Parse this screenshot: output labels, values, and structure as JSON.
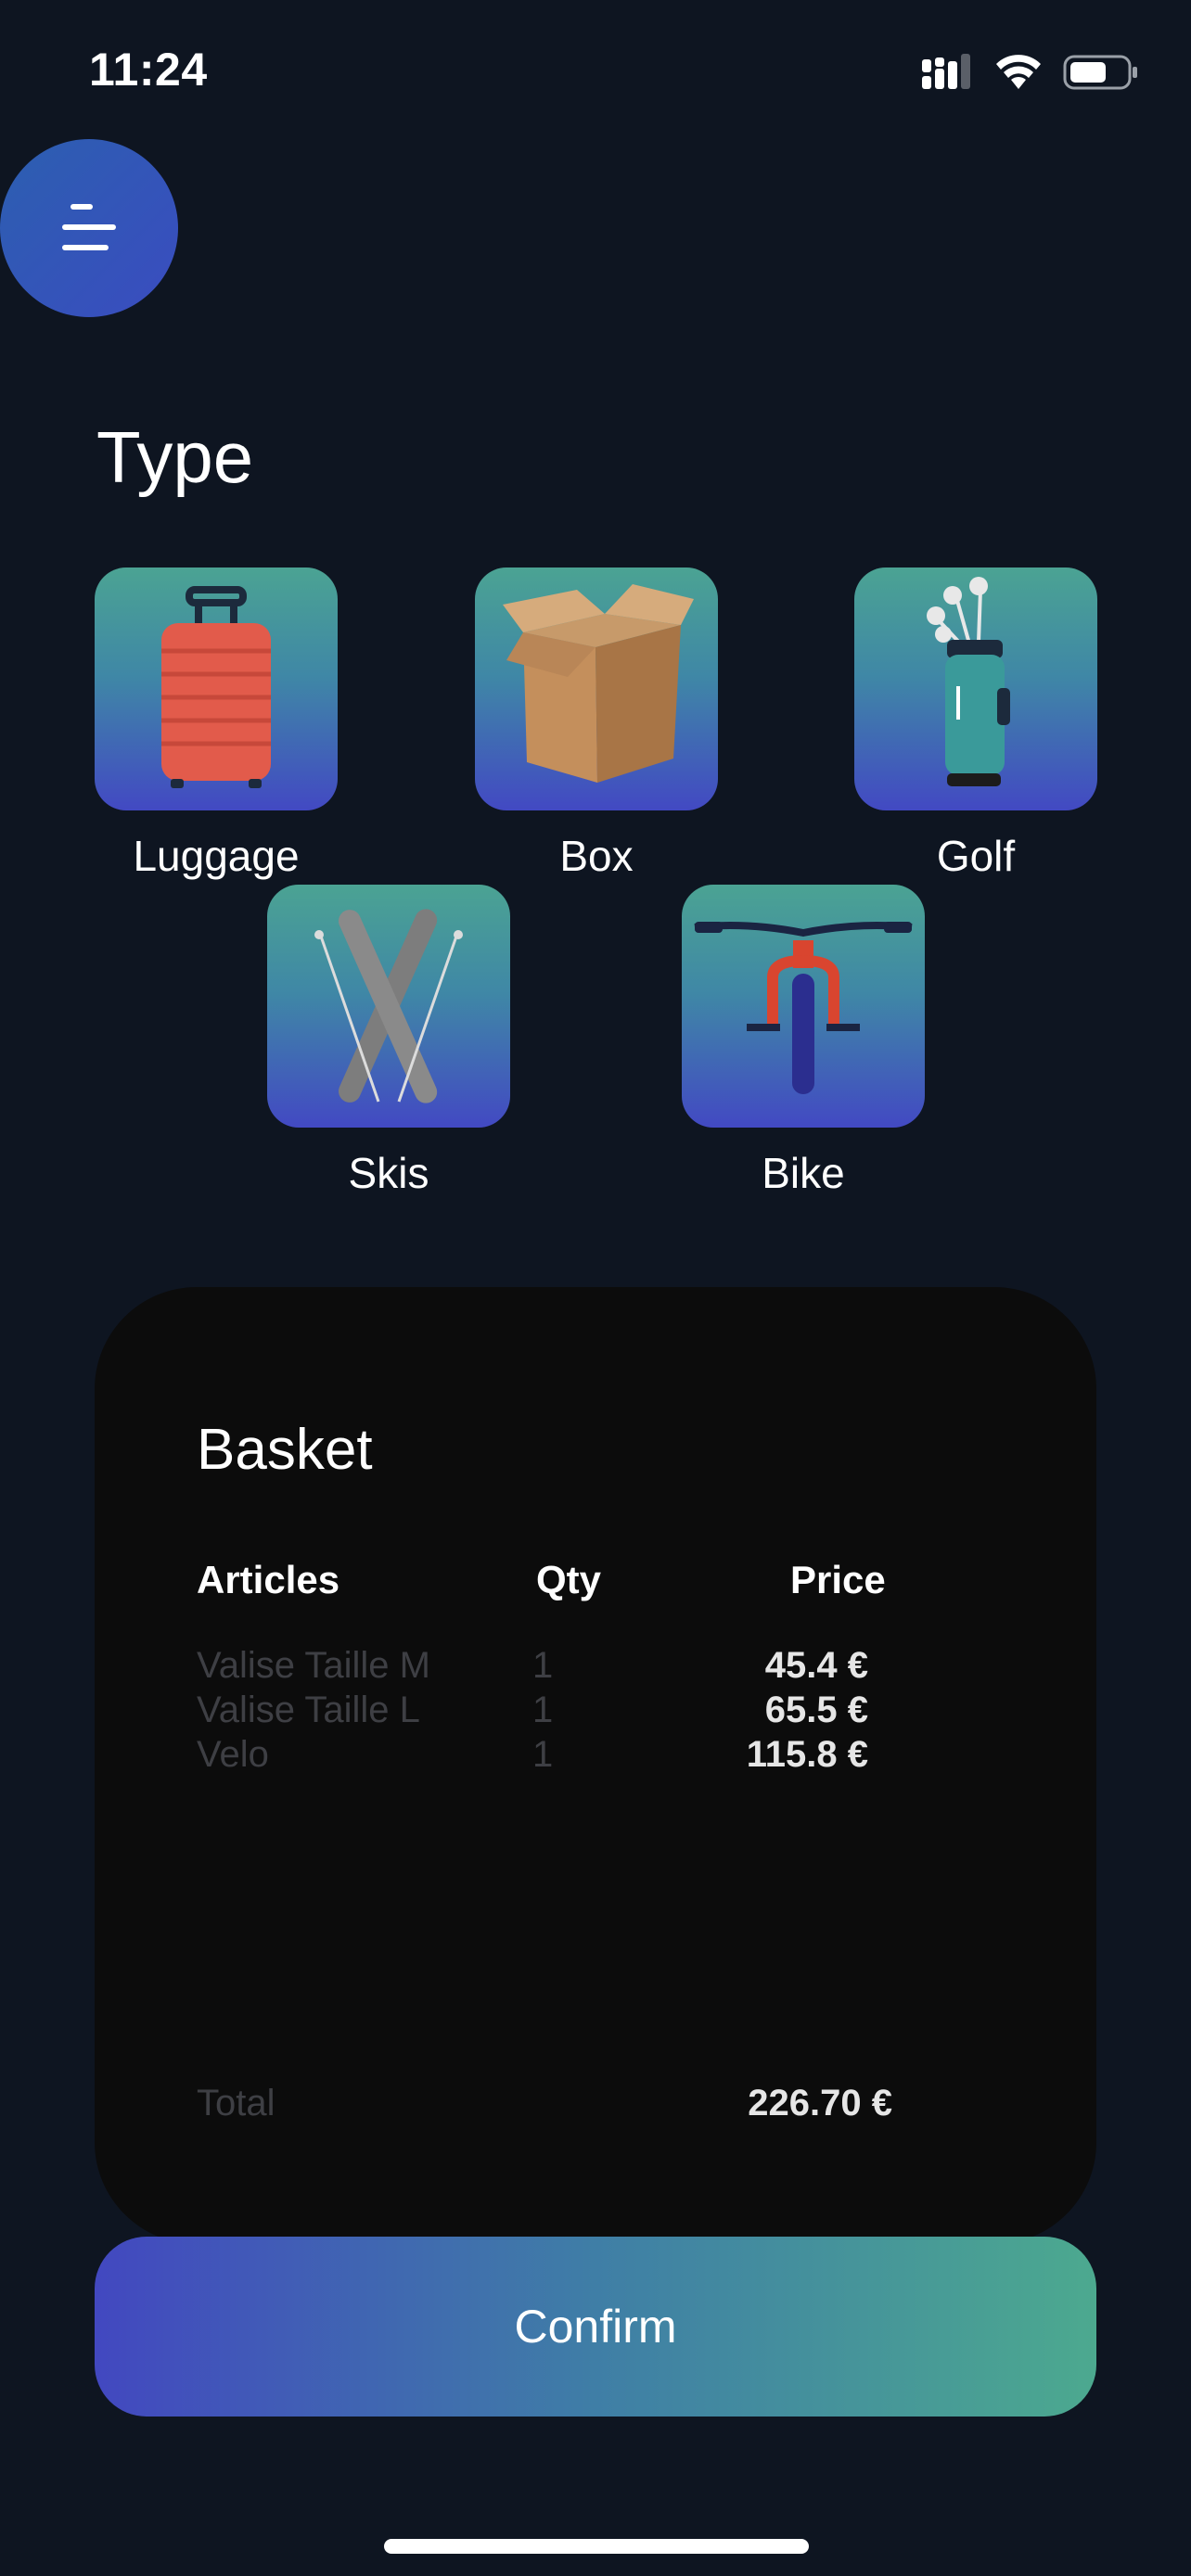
{
  "status_bar": {
    "time": "11:24"
  },
  "page": {
    "title": "Type"
  },
  "types": [
    {
      "label": "Luggage",
      "icon": "luggage-icon"
    },
    {
      "label": "Box",
      "icon": "box-icon"
    },
    {
      "label": "Golf",
      "icon": "golf-bag-icon"
    },
    {
      "label": "Skis",
      "icon": "skis-icon"
    },
    {
      "label": "Bike",
      "icon": "bike-icon"
    }
  ],
  "basket": {
    "title": "Basket",
    "headers": {
      "articles": "Articles",
      "qty": "Qty",
      "price": "Price"
    },
    "items": [
      {
        "article": "Valise Taille M",
        "qty": "1",
        "price": "45.4 €"
      },
      {
        "article": "Valise Taille L",
        "qty": "1",
        "price": "65.5 €"
      },
      {
        "article": "Velo",
        "qty": "1",
        "price": "115.8 €"
      }
    ],
    "total_label": "Total",
    "total_value": "226.70 €"
  },
  "confirm_label": "Confirm",
  "colors": {
    "background": "#0e1521",
    "card": "#0c0c0c",
    "accent_start": "#4248c0",
    "accent_end": "#4ca98f",
    "muted_text": "#3e3f44"
  }
}
